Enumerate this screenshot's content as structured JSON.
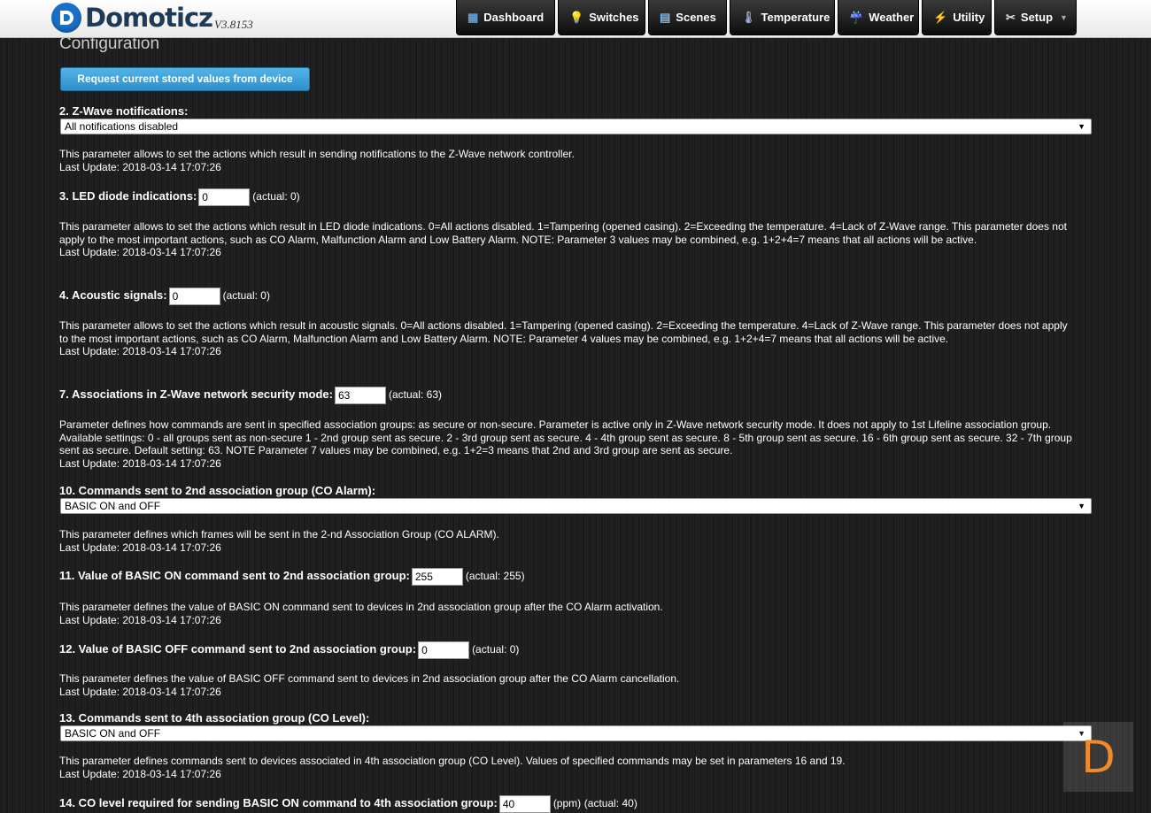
{
  "app": {
    "name": "Domoticz",
    "version": "V3.8153"
  },
  "nav": [
    {
      "label": "Dashboard",
      "icon": "dashboard-icon",
      "glyph": "▦"
    },
    {
      "label": "Switches",
      "icon": "lightbulb-icon",
      "glyph": "💡"
    },
    {
      "label": "Scenes",
      "icon": "scenes-icon",
      "glyph": "▤"
    },
    {
      "label": "Temperature",
      "icon": "thermometer-icon",
      "glyph": "🌡"
    },
    {
      "label": "Weather",
      "icon": "weather-icon",
      "glyph": "☔"
    },
    {
      "label": "Utility",
      "icon": "utility-icon",
      "glyph": "⚡"
    },
    {
      "label": "Setup",
      "icon": "tools-icon",
      "glyph": "✂"
    }
  ],
  "page": {
    "title": "Configuration",
    "request_button": "Request current stored values from device"
  },
  "params": {
    "p2": {
      "label": "2. Z-Wave notifications:",
      "value": "All notifications disabled",
      "desc": "This parameter allows to set the actions which result in sending notifications to the Z-Wave network controller.",
      "last_update": "Last Update: 2018-03-14 17:07:26"
    },
    "p3": {
      "label": "3. LED diode indications:",
      "value": "0",
      "actual": "(actual: 0)",
      "desc": "This parameter allows to set the actions which result in LED diode indications. 0=All actions disabled. 1=Tampering (opened casing). 2=Exceeding the temperature. 4=Lack of Z-Wave range. This parameter does not apply to the most important actions, such as CO Alarm, Malfunction Alarm and Low Battery Alarm. NOTE: Parameter 3 values may be combined, e.g. 1+2+4=7 means that all actions will be active.",
      "last_update": "Last Update: 2018-03-14 17:07:26"
    },
    "p4": {
      "label": "4. Acoustic signals:",
      "value": "0",
      "actual": "(actual: 0)",
      "desc": "This parameter allows to set the actions which result in acoustic signals. 0=All actions disabled. 1=Tampering (opened casing). 2=Exceeding the temperature. 4=Lack of Z-Wave range. This parameter does not apply to the most important actions, such as CO Alarm, Malfunction Alarm and Low Battery Alarm. NOTE: Parameter 4 values may be combined, e.g. 1+2+4=7 means that all actions will be active.",
      "last_update": "Last Update: 2018-03-14 17:07:26"
    },
    "p7": {
      "label": "7. Associations in Z-Wave network security mode:",
      "value": "63",
      "actual": "(actual: 63)",
      "desc": "Parameter defines how commands are sent in specified association groups: as secure or non-secure. Parameter is active only in Z-Wave network security mode. It does not apply to 1st Lifeline association group. Available settings: 0 - all groups sent as non-secure 1 - 2nd group sent as secure. 2 - 3rd group sent as secure. 4 - 4th group sent as secure. 8 - 5th group sent as secure. 16 - 6th group sent as secure. 32 - 7th group sent as secure. Default setting: 63. NOTE Parameter 7 values may be combined, e.g. 1+2=3 means that 2nd and 3rd group are sent as secure.",
      "last_update": "Last Update: 2018-03-14 17:07:26"
    },
    "p10": {
      "label": "10. Commands sent to 2nd association group (CO Alarm):",
      "value": "BASIC ON and OFF",
      "desc": "This parameter defines which frames will be sent in the 2-nd Association Group (CO ALARM).",
      "last_update": "Last Update: 2018-03-14 17:07:26"
    },
    "p11": {
      "label": "11. Value of BASIC ON command sent to 2nd association group:",
      "value": "255",
      "actual": "(actual: 255)",
      "desc": "This parameter defines the value of BASIC ON command sent to devices in 2nd association group after the CO Alarm activation.",
      "last_update": "Last Update: 2018-03-14 17:07:26"
    },
    "p12": {
      "label": "12. Value of BASIC OFF command sent to 2nd association group:",
      "value": "0",
      "actual": "(actual: 0)",
      "desc": "This parameter defines the value of BASIC OFF command sent to devices in 2nd association group after the CO Alarm cancellation.",
      "last_update": "Last Update: 2018-03-14 17:07:26"
    },
    "p13": {
      "label": "13. Commands sent to 4th association group (CO Level):",
      "value": "BASIC ON and OFF",
      "desc": "This parameter defines commands sent to devices associated in 4th association group (CO Level). Values of specified commands may be set in parameters 16 and 19.",
      "last_update": "Last Update: 2018-03-14 17:07:26"
    },
    "p14": {
      "label": "14. CO level required for sending BASIC ON command to 4th association group:",
      "value": "40",
      "unit": "(ppm)",
      "actual": "(actual: 40)"
    }
  },
  "watermark": {
    "letter": "D",
    "color": "#f08a2a"
  },
  "colors": {
    "accent": "#2f8fcc",
    "background": "#1e1e1e"
  }
}
